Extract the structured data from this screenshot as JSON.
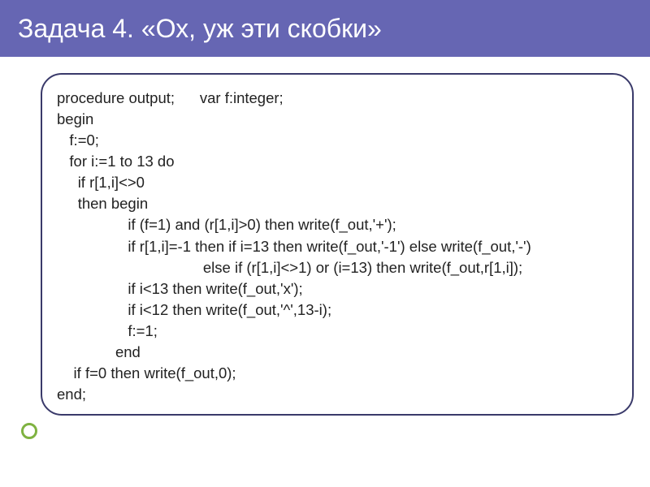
{
  "slide": {
    "title": "Задача 4. «Ох, уж эти скобки»"
  },
  "code": {
    "lines": [
      "procedure output;      var f:integer;",
      "begin",
      "   f:=0;",
      "   for i:=1 to 13 do",
      "     if r[1,i]<>0",
      "     then begin",
      "                 if (f=1) and (r[1,i]>0) then write(f_out,'+');",
      "                 if r[1,i]=-1 then if i=13 then write(f_out,'-1') else write(f_out,'-')",
      "                                   else if (r[1,i]<>1) or (i=13) then write(f_out,r[1,i]);",
      "                 if i<13 then write(f_out,'x');",
      "                 if i<12 then write(f_out,'^',13-i);",
      "                 f:=1;",
      "              end",
      "    if f=0 then write(f_out,0);",
      "end;"
    ]
  }
}
